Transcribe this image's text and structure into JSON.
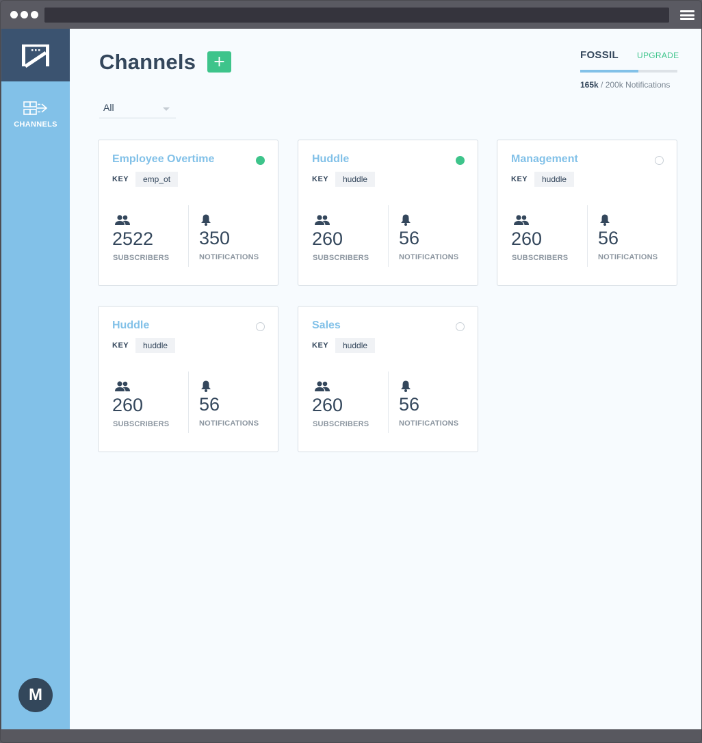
{
  "sidebar": {
    "nav": [
      {
        "label": "CHANNELS",
        "icon": "channels-icon"
      }
    ],
    "avatar_initial": "M"
  },
  "page": {
    "title": "Channels",
    "add_label": "+"
  },
  "filter": {
    "value": "All"
  },
  "plan": {
    "name": "FOSSIL",
    "upgrade_label": "UPGRADE",
    "used": "165k",
    "limit_text": " / 200k Notifications",
    "usage_fraction": 0.6
  },
  "key_label": "KEY",
  "subscribers_label": "SUBSCRIBERS",
  "notifications_label": "NOTIFICATIONS",
  "channels": [
    {
      "name": "Employee Overtime",
      "key": "emp_ot",
      "active": true,
      "subscribers": "2522",
      "notifications": "350"
    },
    {
      "name": "Huddle",
      "key": "huddle",
      "active": true,
      "subscribers": "260",
      "notifications": "56"
    },
    {
      "name": "Management",
      "key": "huddle",
      "active": false,
      "subscribers": "260",
      "notifications": "56"
    },
    {
      "name": "Huddle",
      "key": "huddle",
      "active": false,
      "subscribers": "260",
      "notifications": "56"
    },
    {
      "name": "Sales",
      "key": "huddle",
      "active": false,
      "subscribers": "260",
      "notifications": "56"
    }
  ],
  "colors": {
    "accent": "#82c1e8",
    "success": "#3ec48b",
    "dark": "#34475c"
  }
}
